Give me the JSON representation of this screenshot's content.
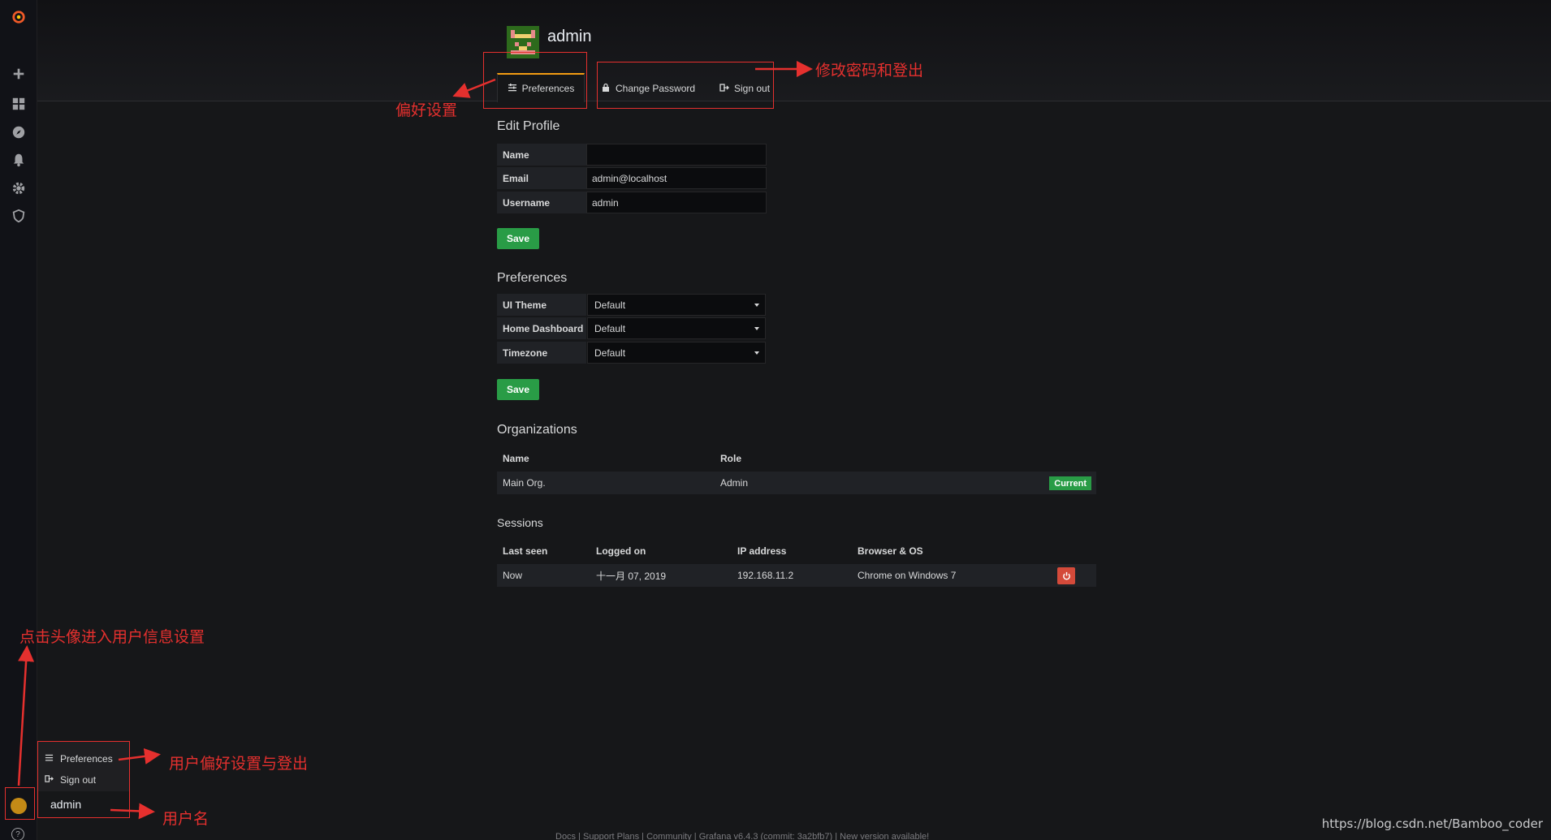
{
  "header": {
    "title": "admin",
    "tabs": [
      {
        "label": "Preferences",
        "icon": "sliders-icon"
      },
      {
        "label": "Change Password",
        "icon": "lock-icon"
      },
      {
        "label": "Sign out",
        "icon": "sign-out-icon"
      }
    ]
  },
  "edit_profile": {
    "title": "Edit Profile",
    "fields": [
      {
        "label": "Name",
        "value": ""
      },
      {
        "label": "Email",
        "value": "admin@localhost"
      },
      {
        "label": "Username",
        "value": "admin"
      }
    ],
    "save_label": "Save"
  },
  "preferences": {
    "title": "Preferences",
    "fields": [
      {
        "label": "UI Theme",
        "value": "Default"
      },
      {
        "label": "Home Dashboard",
        "value": "Default"
      },
      {
        "label": "Timezone",
        "value": "Default"
      }
    ],
    "save_label": "Save"
  },
  "organizations": {
    "title": "Organizations",
    "headers": [
      "Name",
      "Role"
    ],
    "rows": [
      {
        "name": "Main Org.",
        "role": "Admin",
        "badge": "Current"
      }
    ]
  },
  "sessions": {
    "title": "Sessions",
    "headers": [
      "Last seen",
      "Logged on",
      "IP address",
      "Browser & OS"
    ],
    "rows": [
      {
        "last_seen": "Now",
        "logged_on": "十一月 07, 2019",
        "ip": "192.168.11.2",
        "browser": "Chrome on Windows 7"
      }
    ]
  },
  "popup": {
    "items": [
      "Preferences",
      "Sign out"
    ],
    "username": "admin"
  },
  "annotations": {
    "preferences": "偏好设置",
    "change_password": "修改密码和登出",
    "avatar": "点击头像进入用户信息设置",
    "popup": "用户偏好设置与登出",
    "username": "用户名"
  },
  "footer": "Docs | Support Plans | Community | Grafana v6.4.3 (commit: 3a2bfb7) | New version available!",
  "watermark": "https://blog.csdn.net/Bamboo_coder",
  "colors": {
    "accent": "#f39c12",
    "save": "#299c46",
    "danger": "#d44a3a",
    "annotation": "#e5302e"
  }
}
